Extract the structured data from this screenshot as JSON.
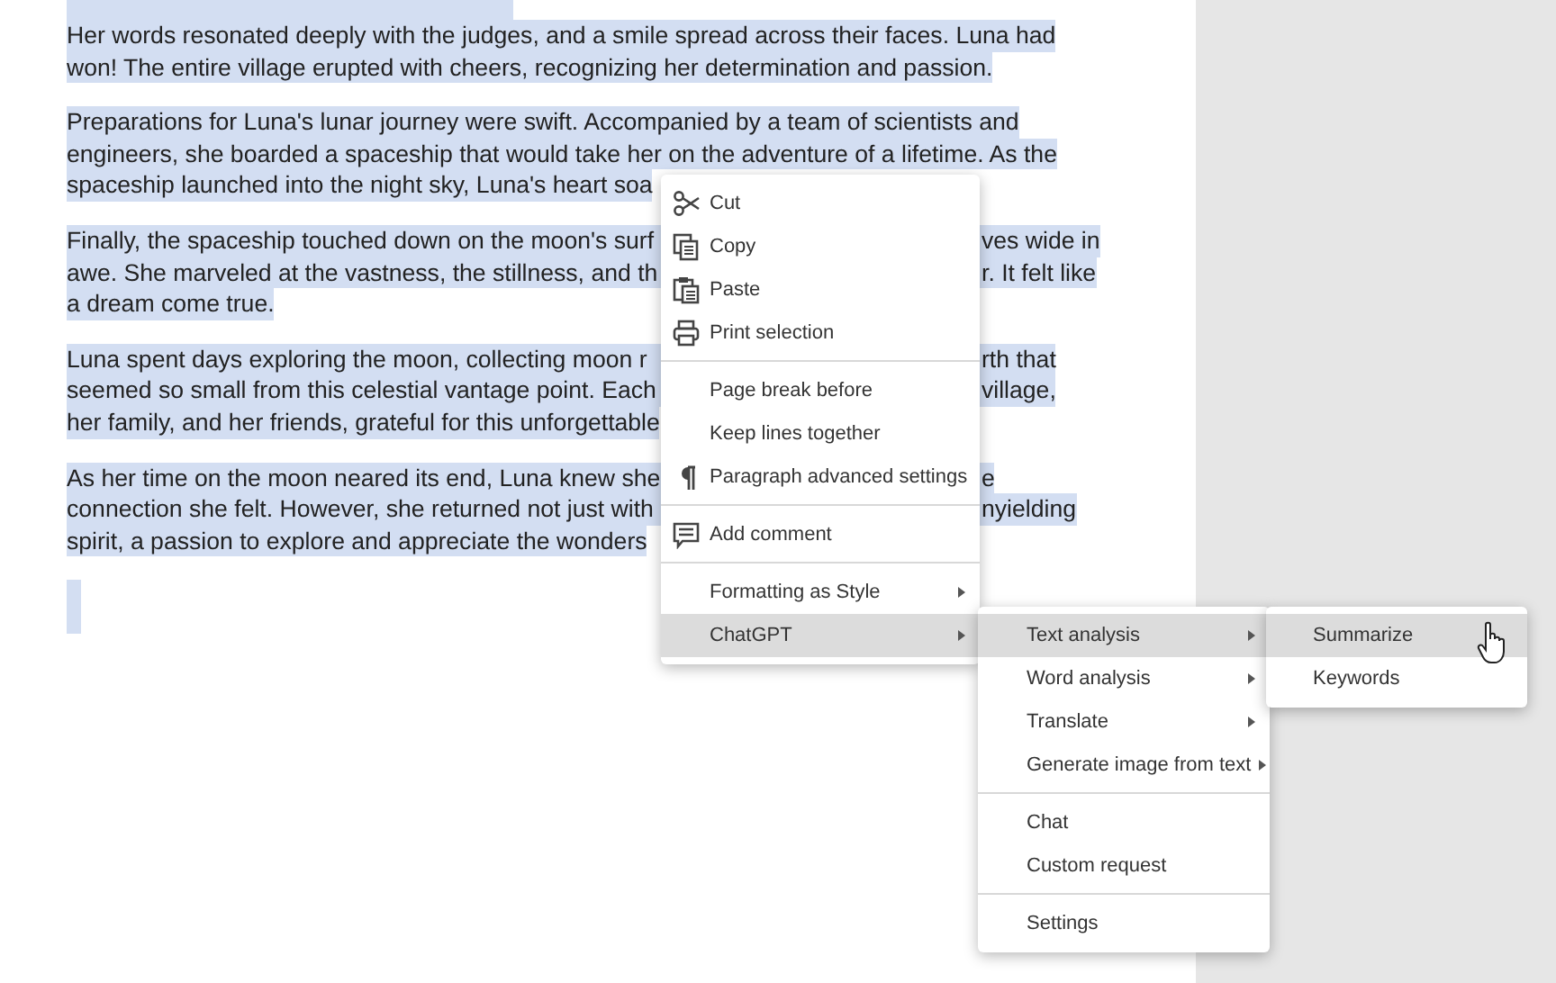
{
  "document": {
    "paragraphs": [
      {
        "selected": true,
        "lines": [
          {
            "segments": [
              "Her words resonated deeply with the judges, and a smile spread across their faces. Luna had"
            ]
          },
          {
            "segments": [
              "won! The entire village erupted with cheers, recognizing her determination and passion."
            ]
          }
        ]
      },
      {
        "selected": true,
        "lines": [
          {
            "segments": [
              "Preparations for Luna's lunar journey were swift. Accompanied by a team of scientists and"
            ]
          },
          {
            "segments": [
              "engineers, she boarded a spaceship that would take her on the adventure of a lifetime. As the"
            ]
          },
          {
            "segments": [
              "spaceship launched into the night sky, Luna's heart soa"
            ]
          }
        ]
      },
      {
        "selected": true,
        "lines": [
          {
            "segments": [
              "Finally, the spaceship touched down on the moon's surf",
              "ves wide in"
            ]
          },
          {
            "segments": [
              "awe. She marveled at the vastness, the stillness, and th",
              "r. It felt like"
            ]
          },
          {
            "segments": [
              "a dream come true."
            ]
          }
        ]
      },
      {
        "selected": true,
        "lines": [
          {
            "segments": [
              "Luna spent days exploring the moon, collecting moon r",
              "rth that"
            ]
          },
          {
            "segments": [
              "seemed so small from this celestial vantage point. Each",
              "village,"
            ]
          },
          {
            "segments": [
              "her family, and her friends, grateful for this unforgettable"
            ]
          }
        ]
      },
      {
        "selected": true,
        "lines": [
          {
            "segments": [
              "As her time on the moon neared its end, Luna knew she",
              "e"
            ]
          },
          {
            "segments": [
              "connection she felt. However, she returned not just with",
              "nyielding"
            ]
          },
          {
            "segments": [
              "spirit, a passion to explore and appreciate the wonders"
            ]
          }
        ]
      }
    ]
  },
  "context_menu": {
    "items": [
      {
        "kind": "scissors",
        "label": "Cut",
        "submenu": false,
        "selected": false
      },
      {
        "kind": "copy",
        "label": "Copy",
        "submenu": false,
        "selected": false
      },
      {
        "kind": "paste",
        "label": "Paste",
        "submenu": false,
        "selected": false
      },
      {
        "kind": "printer",
        "label": "Print selection",
        "submenu": false,
        "selected": false
      },
      {
        "kind": "divider"
      },
      {
        "kind": "item",
        "label": "Page break before",
        "submenu": false,
        "selected": false
      },
      {
        "kind": "item",
        "label": "Keep lines together",
        "submenu": false,
        "selected": false
      },
      {
        "kind": "pilcrow",
        "label": "Paragraph advanced settings",
        "submenu": false,
        "selected": false
      },
      {
        "kind": "divider"
      },
      {
        "kind": "comment",
        "label": "Add comment",
        "submenu": false,
        "selected": false
      },
      {
        "kind": "divider"
      },
      {
        "kind": "item",
        "label": "Formatting as Style",
        "submenu": true,
        "selected": false
      },
      {
        "kind": "item",
        "label": "ChatGPT",
        "submenu": true,
        "selected": true
      }
    ]
  },
  "chatgpt_submenu": {
    "items": [
      {
        "kind": "item",
        "label": "Text analysis",
        "submenu": true,
        "selected": true
      },
      {
        "kind": "item",
        "label": "Word analysis",
        "submenu": true,
        "selected": false
      },
      {
        "kind": "item",
        "label": "Translate",
        "submenu": true,
        "selected": false
      },
      {
        "kind": "item",
        "label": "Generate image from text",
        "submenu": true,
        "selected": false
      },
      {
        "kind": "divider"
      },
      {
        "kind": "item",
        "label": "Chat",
        "submenu": false,
        "selected": false
      },
      {
        "kind": "item",
        "label": "Custom request",
        "submenu": false,
        "selected": false
      },
      {
        "kind": "divider"
      },
      {
        "kind": "item",
        "label": "Settings",
        "submenu": false,
        "selected": false
      }
    ]
  },
  "text_analysis_submenu": {
    "items": [
      {
        "kind": "item",
        "label": "Summarize",
        "submenu": false,
        "selected": true
      },
      {
        "kind": "item",
        "label": "Keywords",
        "submenu": false,
        "selected": false
      }
    ]
  }
}
